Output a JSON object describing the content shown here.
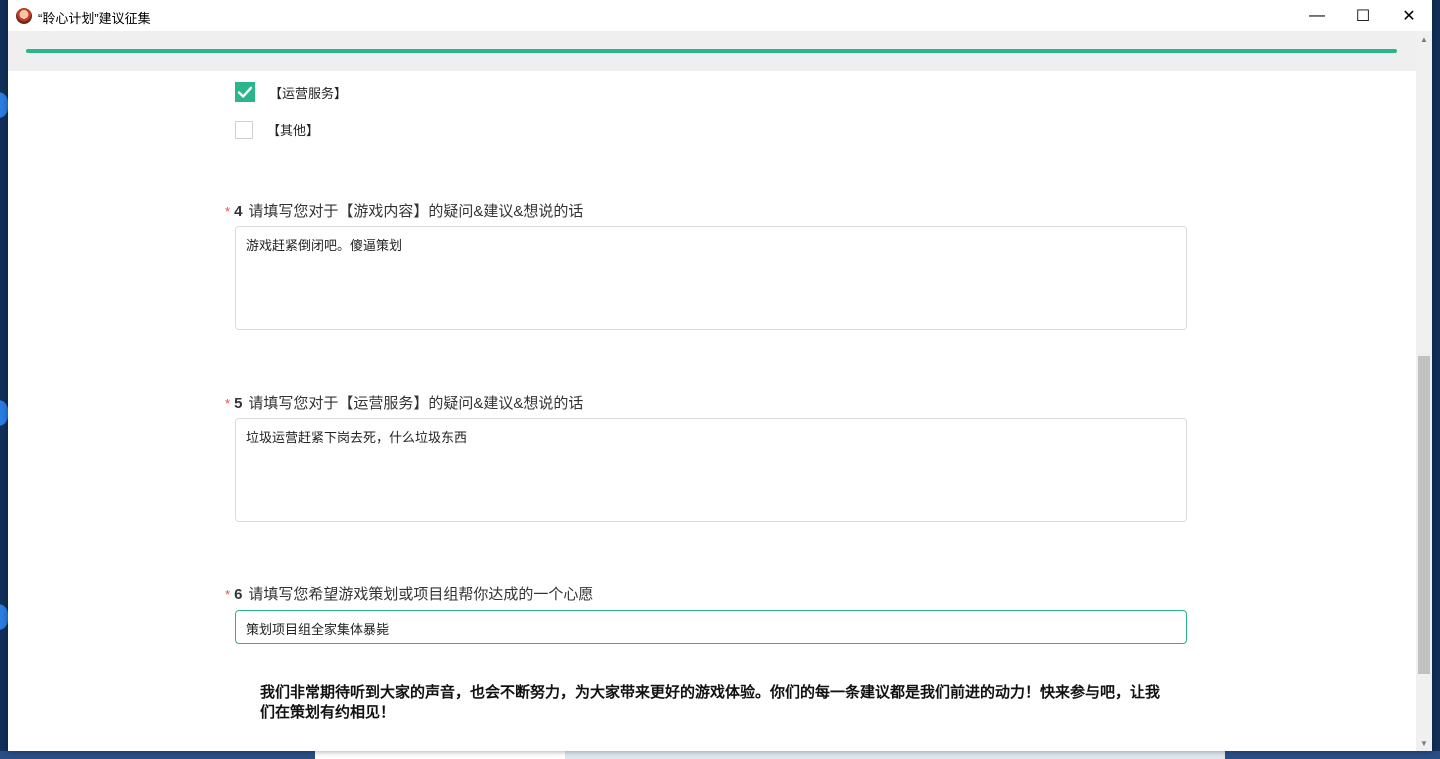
{
  "window": {
    "title": "“聆心计划”建议征集",
    "controls": {
      "minimize": "—",
      "maximize": "☐",
      "close": "✕"
    }
  },
  "progress": {
    "fraction": 1.0,
    "color": "#2ab58a"
  },
  "question3": {
    "options": [
      {
        "label": "【运营服务】",
        "checked": true
      },
      {
        "label": "【其他】",
        "checked": false
      }
    ]
  },
  "question4": {
    "required_mark": "*",
    "number": "4",
    "text": "请填写您对于【游戏内容】的疑问&建议&想说的话",
    "answer": "游戏赶紧倒闭吧。傻逼策划"
  },
  "question5": {
    "required_mark": "*",
    "number": "5",
    "text": "请填写您对于【运营服务】的疑问&建议&想说的话",
    "answer": "垃圾运营赶紧下岗去死，什么垃圾东西"
  },
  "question6": {
    "required_mark": "*",
    "number": "6",
    "text": "请填写您希望游戏策划或项目组帮你达成的一个心愿",
    "answer": "策划项目组全家集体暴毙"
  },
  "footer": {
    "message": "我们非常期待听到大家的声音，也会不断努力，为大家带来更好的游戏体验。你们的每一条建议都是我们前进的动力！快来参与吧，让我们在策划有约相见！"
  },
  "colors": {
    "accent": "#2ab58a",
    "required": "#e84e4e"
  }
}
